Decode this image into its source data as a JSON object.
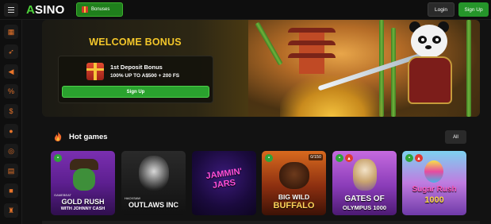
{
  "header": {
    "logo_text": "SINO",
    "logo_accent": "A",
    "bonuses_label": "Bonuses",
    "login_label": "Login",
    "signup_label": "Sign Up"
  },
  "sidebar": {
    "items": [
      {
        "icon": "grid-icon"
      },
      {
        "icon": "rocket-icon"
      },
      {
        "icon": "megaphone-icon"
      },
      {
        "icon": "percent-icon"
      },
      {
        "icon": "coin-icon"
      },
      {
        "icon": "medal-icon"
      },
      {
        "icon": "target-icon"
      },
      {
        "icon": "book-icon"
      },
      {
        "icon": "gift-icon"
      },
      {
        "icon": "trophy-icon"
      }
    ]
  },
  "hero": {
    "welcome_title": "WELCOME BONUS",
    "bonus_name": "1st Deposit Bonus",
    "bonus_desc": "100% UP TO A$500 + 200 FS",
    "signup_label": "Sign Up"
  },
  "hot_games": {
    "title": "Hot games",
    "all_label": "All",
    "games": [
      {
        "title_line1": "GOLD RUSH",
        "title_line2": "WITH JOHNNY CASH",
        "provider": "GAMEBEAT"
      },
      {
        "title_line1": "OUTLAWS INC",
        "title_line2": "",
        "provider": "HACKSAW"
      },
      {
        "title_line1": "JAMMIN'",
        "title_line2": "JARS",
        "provider": ""
      },
      {
        "title_line1": "BIG WILD",
        "title_line2": "BUFFALO",
        "count": "0/150"
      },
      {
        "title_line1": "GATES OF",
        "title_line2": "OLYMPUS 1000"
      },
      {
        "title_line1": "Sugar Rush",
        "title_line2": "1000"
      }
    ]
  },
  "colors": {
    "brand_green": "#25952a",
    "gold": "#f4c72a",
    "sidebar_icon": "#e8742a"
  }
}
